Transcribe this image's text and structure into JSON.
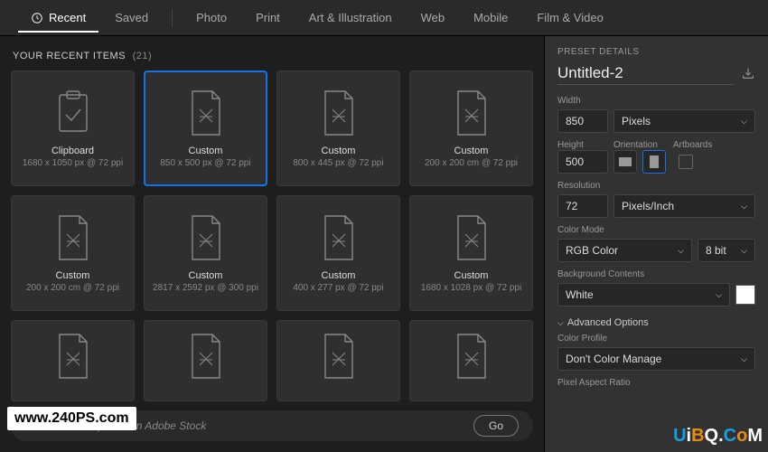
{
  "tabs": {
    "recent": "Recent",
    "saved": "Saved",
    "photo": "Photo",
    "print": "Print",
    "art": "Art & Illustration",
    "web": "Web",
    "mobile": "Mobile",
    "film": "Film & Video"
  },
  "section": {
    "title": "YOUR RECENT ITEMS",
    "count": "(21)"
  },
  "cards": [
    {
      "title": "Clipboard",
      "sub": "1680 x 1050 px @ 72 ppi",
      "kind": "clipboard"
    },
    {
      "title": "Custom",
      "sub": "850 x 500 px @ 72 ppi",
      "kind": "doc",
      "selected": true
    },
    {
      "title": "Custom",
      "sub": "800 x 445 px @ 72 ppi",
      "kind": "doc"
    },
    {
      "title": "Custom",
      "sub": "200 x 200 cm @ 72 ppi",
      "kind": "doc"
    },
    {
      "title": "Custom",
      "sub": "200 x 200 cm @ 72 ppi",
      "kind": "doc"
    },
    {
      "title": "Custom",
      "sub": "2817 x 2592 px @ 300 ppi",
      "kind": "doc"
    },
    {
      "title": "Custom",
      "sub": "400 x 277 px @ 72 ppi",
      "kind": "doc"
    },
    {
      "title": "Custom",
      "sub": "1680 x 1028 px @ 72 ppi",
      "kind": "doc"
    }
  ],
  "stock": {
    "placeholder": "ore templates on Adobe Stock",
    "go": "Go"
  },
  "panel": {
    "header": "PRESET DETAILS",
    "title": "Untitled-2",
    "width_label": "Width",
    "width": "850",
    "width_unit": "Pixels",
    "height_label": "Height",
    "height": "500",
    "orientation_label": "Orientation",
    "artboards_label": "Artboards",
    "resolution_label": "Resolution",
    "resolution": "72",
    "resolution_unit": "Pixels/Inch",
    "colormode_label": "Color Mode",
    "colormode": "RGB Color",
    "bitdepth": "8 bit",
    "bg_label": "Background Contents",
    "bg": "White",
    "advanced": "Advanced Options",
    "profile_label": "Color Profile",
    "profile": "Don't Color Manage",
    "par_label": "Pixel Aspect Ratio"
  },
  "wm1": "www.240PS.com",
  "wm2": {
    "u": "U",
    "i": "i",
    "b": "B",
    "q": "Q",
    "c": "C",
    "o": "o",
    "m": "M",
    "dot": "."
  }
}
